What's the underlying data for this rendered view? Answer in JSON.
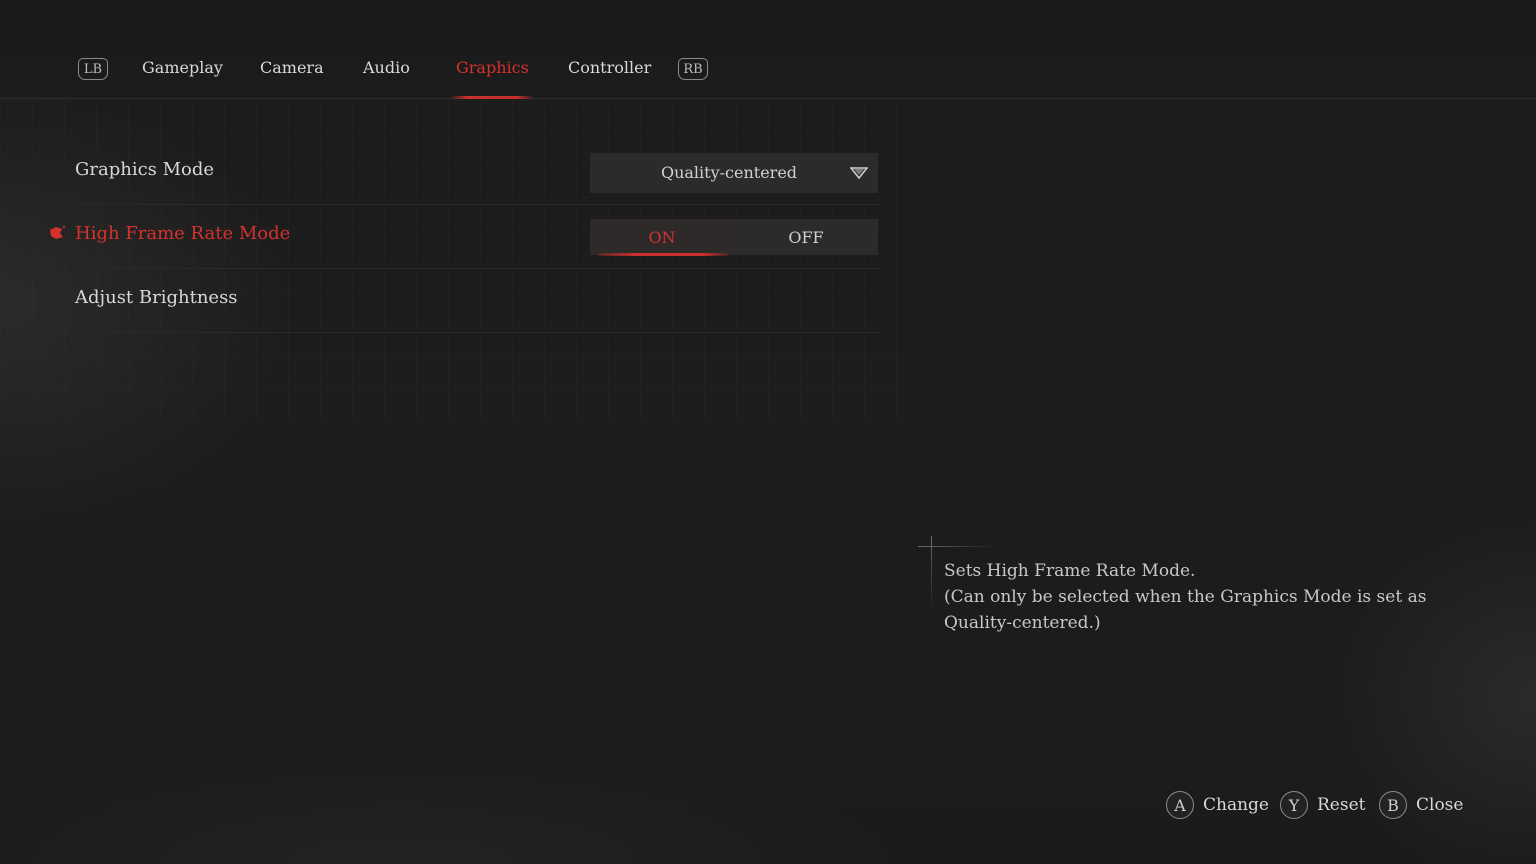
{
  "tabs": {
    "lb_label": "LB",
    "rb_label": "RB",
    "items": [
      {
        "label": "Gameplay"
      },
      {
        "label": "Camera"
      },
      {
        "label": "Audio"
      },
      {
        "label": "Graphics",
        "active": true
      },
      {
        "label": "Controller"
      }
    ]
  },
  "settings": {
    "graphics_mode": {
      "label": "Graphics Mode",
      "value": "Quality-centered"
    },
    "high_frame_rate": {
      "label": "High Frame Rate Mode",
      "on_label": "ON",
      "off_label": "OFF",
      "selected": "ON"
    },
    "brightness": {
      "label": "Adjust Brightness"
    }
  },
  "description": {
    "line1": "Sets High Frame Rate Mode.",
    "line2": "(Can only be selected when the Graphics Mode is set as Quality-centered.)"
  },
  "prompts": [
    {
      "button": "A",
      "label": "Change"
    },
    {
      "button": "Y",
      "label": "Reset"
    },
    {
      "button": "B",
      "label": "Close"
    }
  ],
  "colors": {
    "accent": "#d7312f",
    "background": "#1c1c1c",
    "panel": "#2b2b2b"
  },
  "icons": {
    "cursor": "splatter-cursor-icon",
    "dropdown": "chevron-down-icon"
  }
}
